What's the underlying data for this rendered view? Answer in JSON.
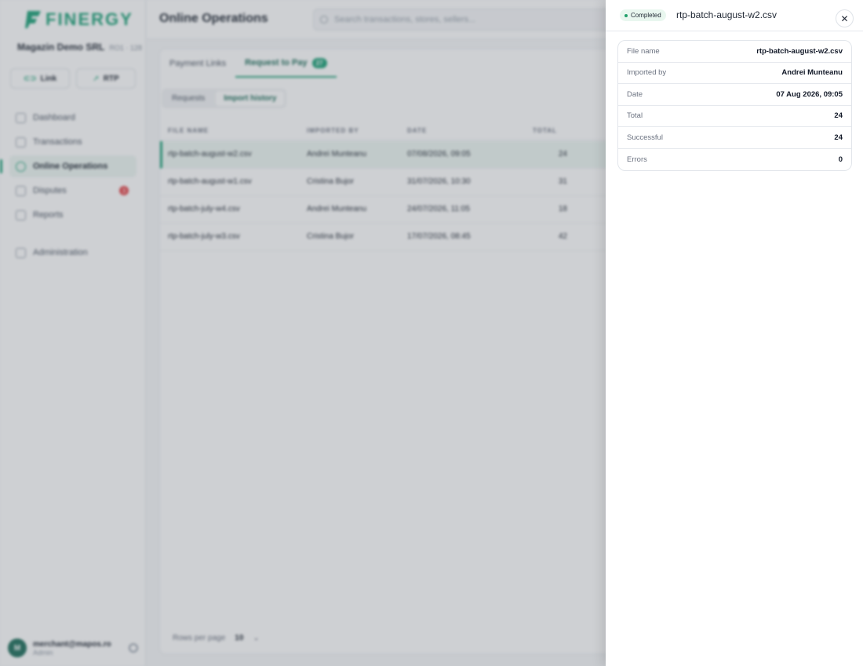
{
  "app": {
    "logo_text": "FINERGY",
    "merchant_name": "Magazin Demo SRL",
    "merchant_tags": "RO1 · 128",
    "quick_actions": [
      {
        "label": "Link"
      },
      {
        "label": "RTP"
      }
    ],
    "nav": [
      {
        "label": "Dashboard"
      },
      {
        "label": "Transactions"
      },
      {
        "label": "Online Operations"
      },
      {
        "label": "Disputes",
        "badge": "3"
      },
      {
        "label": "Reports"
      },
      {
        "label": "Administration"
      }
    ],
    "user": {
      "initial": "M",
      "email": "merchant@mapos.ro",
      "role": "Admin"
    }
  },
  "header": {
    "title": "Online Operations",
    "search_placeholder": "Search transactions, stores, sellers..."
  },
  "main": {
    "tabs": [
      {
        "label": "Payment Links"
      },
      {
        "label": "Request to Pay",
        "count": "27"
      }
    ],
    "segments": [
      {
        "label": "Requests"
      },
      {
        "label": "Import history"
      }
    ],
    "columns": [
      "File name",
      "Imported by",
      "Date",
      "Total"
    ],
    "rows": [
      {
        "file": "rtp-batch-august-w2.csv",
        "by": "Andrei Munteanu",
        "date": "07/08/2026, 09:05",
        "total": "24"
      },
      {
        "file": "rtp-batch-august-w1.csv",
        "by": "Cristina Bujor",
        "date": "31/07/2026, 10:30",
        "total": "31"
      },
      {
        "file": "rtp-batch-july-w4.csv",
        "by": "Andrei Munteanu",
        "date": "24/07/2026, 11:05",
        "total": "18"
      },
      {
        "file": "rtp-batch-july-w3.csv",
        "by": "Cristina Bujor",
        "date": "17/07/2026, 08:45",
        "total": "42"
      }
    ],
    "pager": {
      "label": "Rows per page",
      "value": "10"
    }
  },
  "drawer": {
    "status": "Completed",
    "title": "rtp-batch-august-w2.csv",
    "close_symbol": "✕",
    "details": [
      {
        "label": "File name",
        "value": "rtp-batch-august-w2.csv"
      },
      {
        "label": "Imported by",
        "value": "Andrei Munteanu"
      },
      {
        "label": "Date",
        "value": "07 Aug 2026, 09:05"
      },
      {
        "label": "Total",
        "value": "24"
      },
      {
        "label": "Successful",
        "value": "24"
      },
      {
        "label": "Errors",
        "value": "0"
      }
    ]
  }
}
